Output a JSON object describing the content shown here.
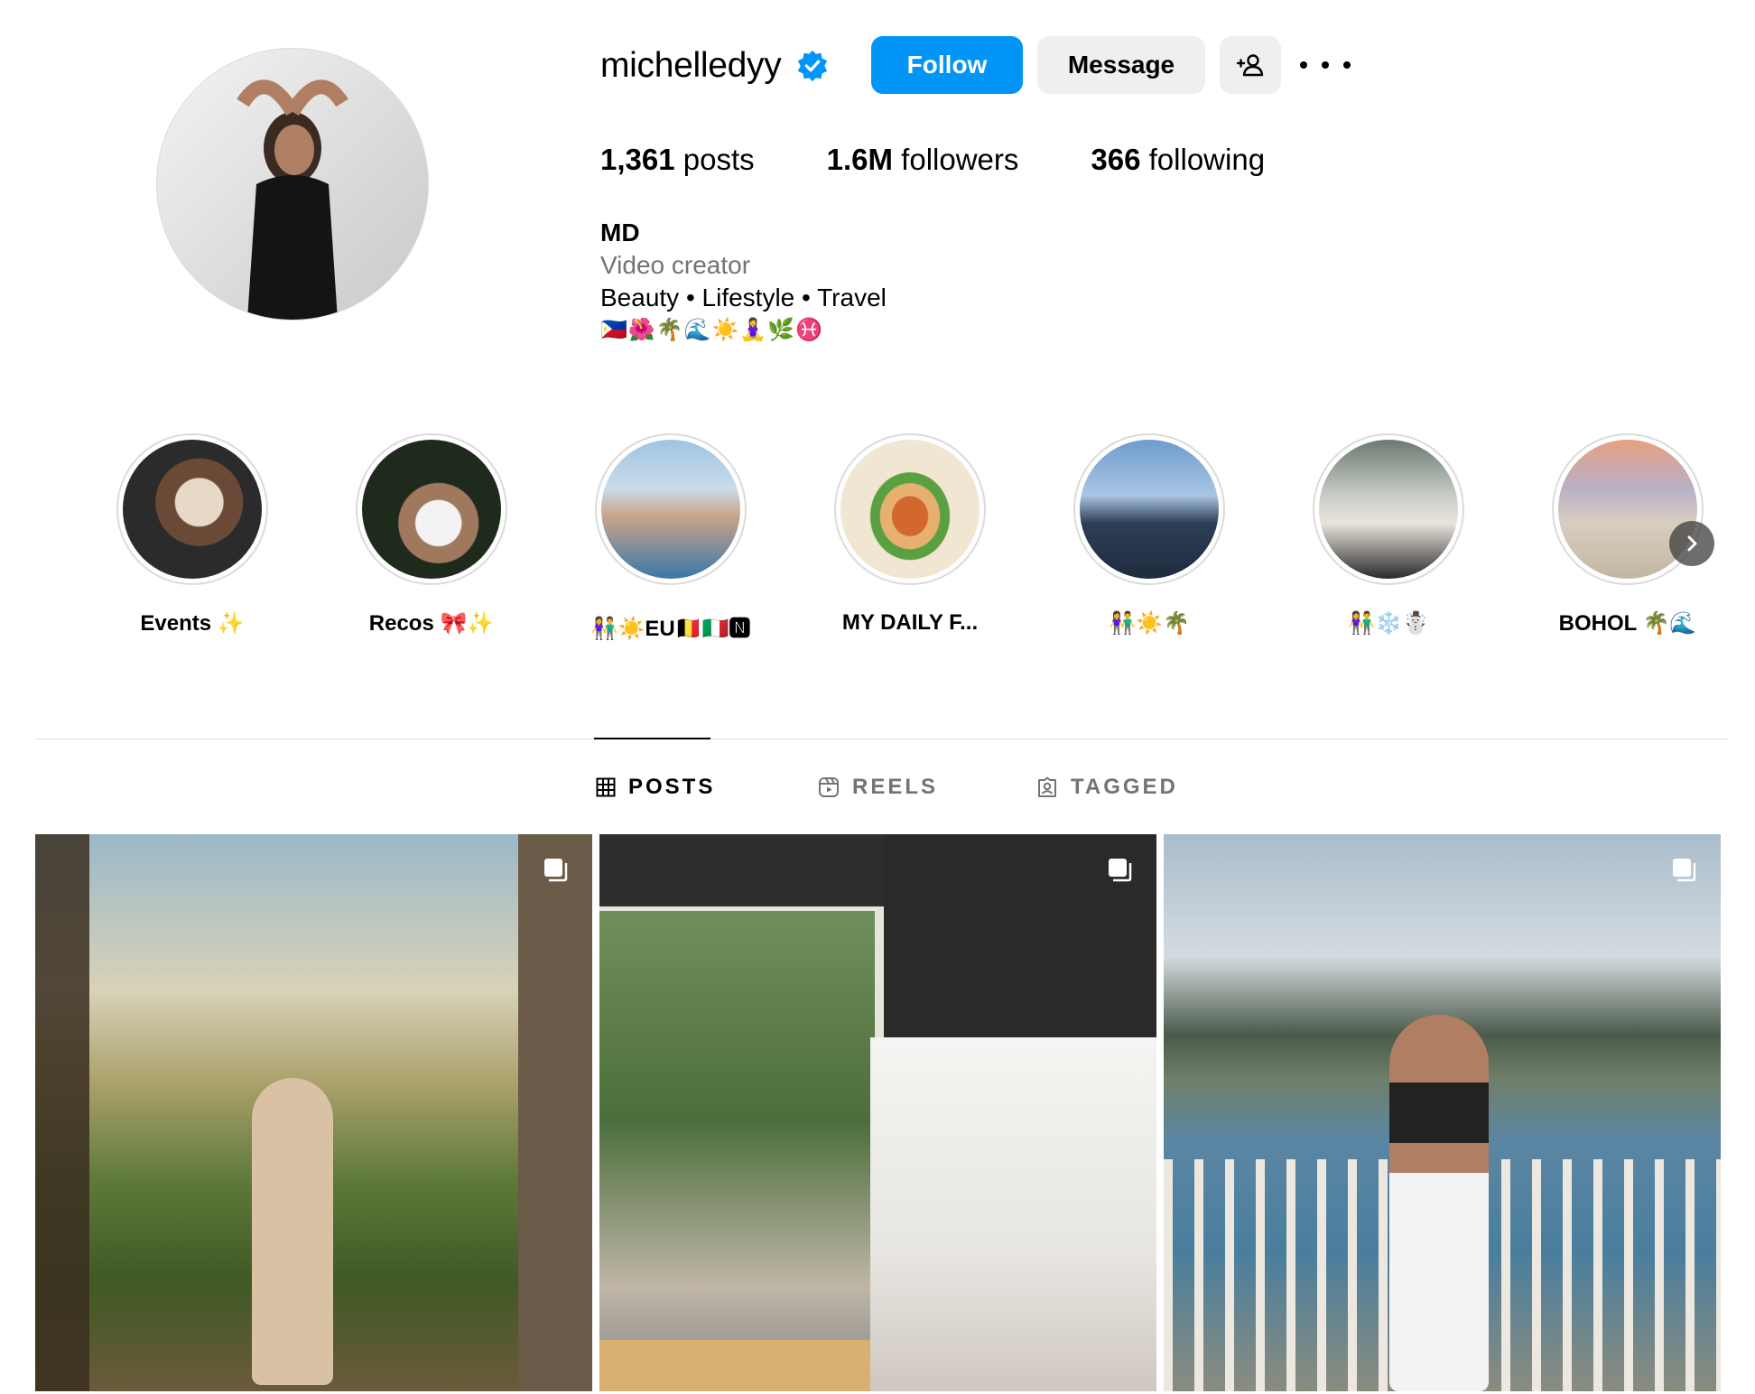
{
  "profile": {
    "username": "michelledyy",
    "verified": true,
    "follow_label": "Follow",
    "message_label": "Message",
    "stats": {
      "posts_count": "1,361",
      "posts_label": " posts",
      "followers_count": "1.6M",
      "followers_label": " followers",
      "following_count": "366",
      "following_label": " following"
    },
    "bio": {
      "name": "MD",
      "category": "Video creator",
      "line1": "Beauty • Lifestyle • Travel",
      "emoji_line": "🇵🇭🌺🌴🌊☀️🧘‍♀️🌿♓️"
    }
  },
  "highlights": [
    {
      "label": "Events ✨"
    },
    {
      "label": "Recos 🎀✨"
    },
    {
      "label": "👫☀️EU🇧🇪🇮🇹🅽"
    },
    {
      "label": "MY DAILY F..."
    },
    {
      "label": "👫☀️🌴"
    },
    {
      "label": "👫❄️☃️"
    },
    {
      "label": "BOHOL 🌴🌊"
    }
  ],
  "tabs": {
    "posts": "POSTS",
    "reels": "REELS",
    "tagged": "TAGGED"
  },
  "colors": {
    "accent": "#0095f6",
    "verified": "#0095f6",
    "button_secondary": "#efefef",
    "muted_text": "#737373",
    "divider": "#dbdbdb"
  },
  "icons": {
    "verified": "verified-badge-icon",
    "suggest": "add-person-icon",
    "more": "more-options-icon",
    "posts_tab": "grid-icon",
    "reels_tab": "reels-icon",
    "tagged_tab": "tagged-icon",
    "carousel": "carousel-icon",
    "next": "chevron-right-icon"
  }
}
